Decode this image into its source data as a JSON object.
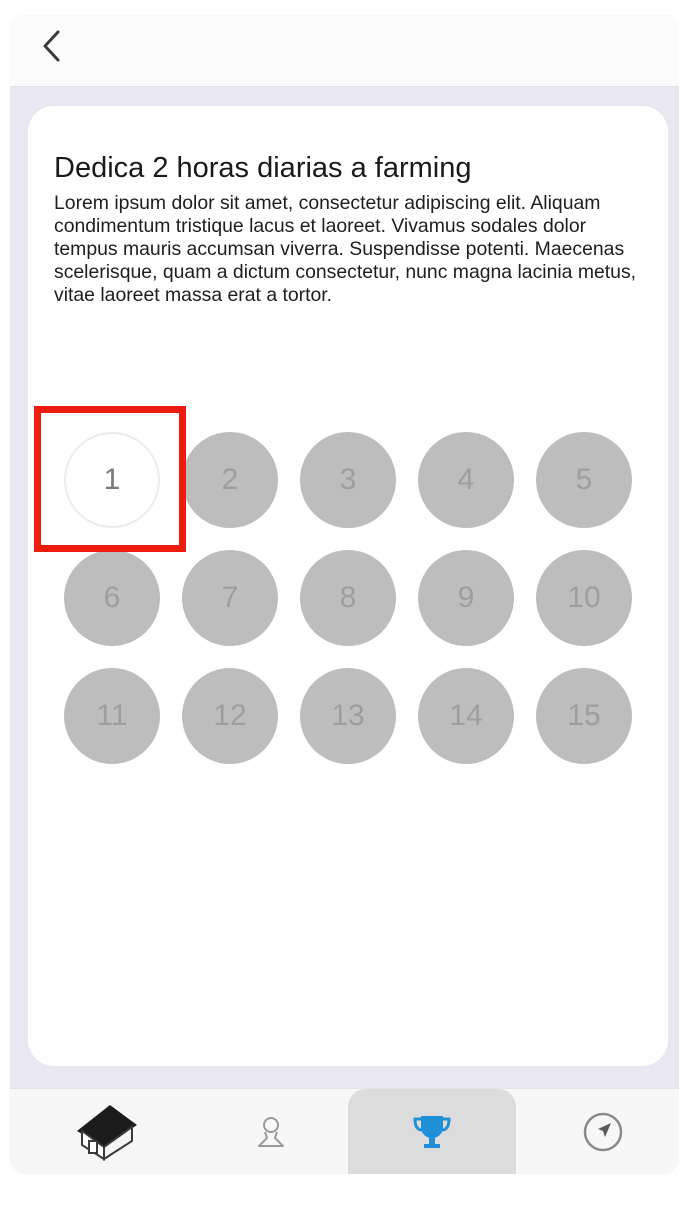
{
  "header": {
    "back_icon": "chevron-left-icon"
  },
  "card": {
    "title": "Dedica 2 horas diarias a farming",
    "description": " Lorem ipsum dolor sit amet, consectetur adipiscing elit. Aliquam condimentum tristique lacus et laoreet. Vivamus sodales dolor tempus mauris accumsan viverra. Suspendisse potenti. Maecenas scelerisque, quam a dictum consectetur, nunc magna lacinia metus, vitae laoreet massa erat a tortor."
  },
  "days": {
    "d1": "1",
    "d2": "2",
    "d3": "3",
    "d4": "4",
    "d5": "5",
    "d6": "6",
    "d7": "7",
    "d8": "8",
    "d9": "9",
    "d10": "10",
    "d11": "11",
    "d12": "12",
    "d13": "13",
    "d14": "14",
    "d15": "15",
    "active_day": "1"
  },
  "tabbar": {
    "tabs": [
      {
        "icon": "home-icon",
        "active": false
      },
      {
        "icon": "profile-icon",
        "active": false
      },
      {
        "icon": "trophy-icon",
        "active": true
      },
      {
        "icon": "navigation-icon",
        "active": false
      }
    ]
  },
  "colors": {
    "accent": "#1f8fd6",
    "highlight": "#ee1c0e",
    "inactive_day": "#bdbdbd",
    "background": "#e9e8f0"
  }
}
